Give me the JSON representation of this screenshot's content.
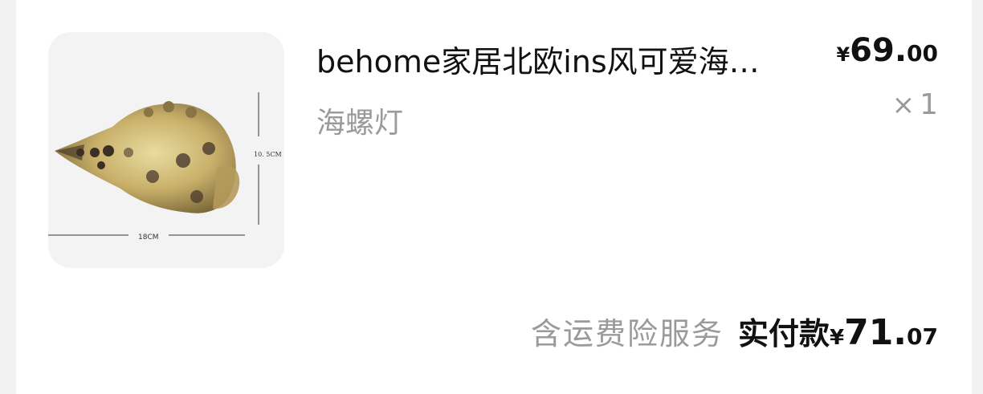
{
  "order_item": {
    "title": "behome家居北欧ins风可爱海…",
    "sku": "海螺灯",
    "image": {
      "width_label": "18CM",
      "height_label": "10. 5CM"
    },
    "price": {
      "currency": "¥",
      "integer": "69.",
      "decimal": "00"
    },
    "quantity": {
      "symbol": "×",
      "value": "1"
    }
  },
  "summary": {
    "service_text": "含运费险服务",
    "paid_label": "实付款",
    "currency": "¥",
    "integer": "71.",
    "decimal": "07"
  }
}
